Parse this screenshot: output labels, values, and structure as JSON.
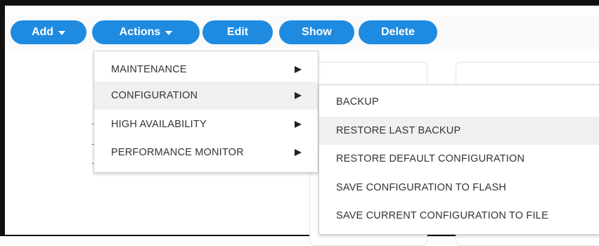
{
  "toolbar": {
    "buttons": [
      {
        "label": "Add",
        "has_caret": true
      },
      {
        "label": "Actions",
        "has_caret": true
      },
      {
        "label": "Edit",
        "has_caret": false
      },
      {
        "label": "Show",
        "has_caret": false
      },
      {
        "label": "Delete",
        "has_caret": false
      }
    ]
  },
  "actions_menu": {
    "items": [
      {
        "label": "MAINTENANCE"
      },
      {
        "label": "CONFIGURATION"
      },
      {
        "label": "HIGH AVAILABILITY"
      },
      {
        "label": "PERFORMANCE MONITOR"
      }
    ]
  },
  "configuration_submenu": {
    "items": [
      {
        "label": "BACKUP"
      },
      {
        "label": "RESTORE LAST BACKUP"
      },
      {
        "label": "RESTORE DEFAULT CONFIGURATION"
      },
      {
        "label": "SAVE CONFIGURATION TO FLASH"
      },
      {
        "label": "SAVE CURRENT CONFIGURATION TO FILE"
      }
    ]
  },
  "colors": {
    "button_bg": "#1f8be0",
    "button_text": "#ffffff",
    "menu_highlight": "#f0f0f0"
  }
}
